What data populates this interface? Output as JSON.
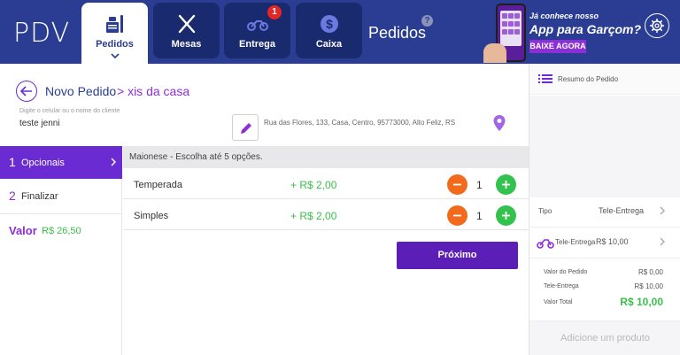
{
  "app": {
    "logo": "PDV"
  },
  "nav": {
    "tabs": [
      {
        "label": "Pedidos",
        "icon": "orders-icon",
        "active": true
      },
      {
        "label": "Mesas",
        "icon": "cutlery-icon"
      },
      {
        "label": "Entrega",
        "icon": "motorcycle-icon",
        "badge": "1"
      },
      {
        "label": "Caixa",
        "icon": "dollar-icon"
      }
    ],
    "section_title": "Pedidos",
    "help": "?"
  },
  "promo": {
    "small": "Já conhece nosso",
    "big": "App para Garçom?",
    "button": "BAIXE AGORA"
  },
  "breadcrumb": {
    "root": "Novo Pedido",
    "current": "> xis da casa"
  },
  "customer": {
    "label": "Digite o celular ou o nome do cliente",
    "value": "teste jenni",
    "address": "Rua das Flores, 133, Casa, Centro, 95773000, Alto Feliz, RS"
  },
  "steps": [
    {
      "num": "1",
      "label": "Opcionais",
      "active": true
    },
    {
      "num": "2",
      "label": "Finalizar"
    }
  ],
  "valor": {
    "label": "Valor",
    "value": "R$ 26,50"
  },
  "options": {
    "header": "Maionese - Escolha até 5 opções.",
    "items": [
      {
        "name": "Temperada",
        "price": "+ R$ 2,00",
        "qty": "1"
      },
      {
        "name": "Simples",
        "price": "+ R$ 2,00",
        "qty": "1"
      }
    ]
  },
  "next_button": "Próximo",
  "summary": {
    "title": "Resumo do Pedido",
    "tipo_label": "Tipo",
    "tipo_value": "Tele-Entrega",
    "delivery_label": "Tele-Entrega",
    "delivery_value": "R$ 10,00",
    "totals": [
      {
        "label": "Valor do Pedido",
        "value": "R$ 0,00"
      },
      {
        "label": "Tele-Entrega",
        "value": "R$ 10,00"
      },
      {
        "label": "Valor Total",
        "value": "R$ 10,00"
      }
    ],
    "add_product": "Adicione um produto"
  },
  "colors": {
    "header": "#2a3d92",
    "tab_dark": "#1a2a6e",
    "accent_purple": "#6a2bd2",
    "button_purple": "#5b1fb8",
    "green": "#3bc04a",
    "orange": "#f26b1d"
  }
}
